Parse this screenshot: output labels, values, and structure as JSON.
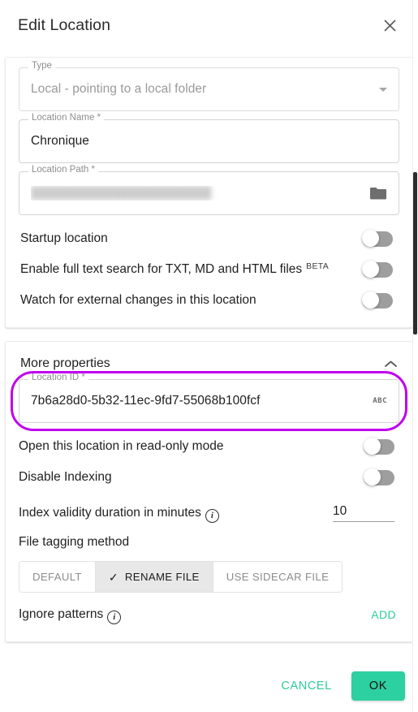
{
  "dialog": {
    "title": "Edit Location",
    "close_icon": "close-icon"
  },
  "fields": {
    "type": {
      "legend": "Type",
      "value": "Local - pointing to a local folder",
      "disabled": true,
      "adornment_icon": "chevron-down-icon"
    },
    "location_name": {
      "legend": "Location Name *",
      "value": "Chronique"
    },
    "location_path": {
      "legend": "Location Path *",
      "value": "██████████████████████",
      "redacted": true,
      "adornment_icon": "folder-icon"
    },
    "location_id": {
      "legend": "Location ID *",
      "value": "7b6a28d0-5b32-11ec-9fd7-55068b100fcf",
      "adornment_icon": "abc-icon",
      "adornment_label": "ABC",
      "highlighted": true
    }
  },
  "toggles": [
    {
      "label": "Startup location",
      "state": "off"
    },
    {
      "label": "Enable full text search for TXT, MD and HTML files",
      "badge": "BETA",
      "state": "off"
    },
    {
      "label": "Watch for external changes in this location",
      "state": "off"
    }
  ],
  "more_properties": {
    "title": "More properties",
    "expanded": true,
    "chevron_icon": "chevron-up-icon",
    "toggles": [
      {
        "label": "Open this location in read-only mode",
        "state": "off"
      },
      {
        "label": "Disable Indexing",
        "state": "off"
      }
    ],
    "index_validity": {
      "label": "Index validity duration in minutes",
      "info_icon": "info-icon",
      "value": "10"
    },
    "file_tagging": {
      "label": "File tagging method",
      "options": [
        {
          "label": "DEFAULT",
          "selected": false
        },
        {
          "label": "RENAME FILE",
          "selected": true,
          "check_icon": "check-icon"
        },
        {
          "label": "USE SIDECAR FILE",
          "selected": false
        }
      ]
    },
    "ignore_patterns": {
      "label": "Ignore patterns",
      "info_icon": "info-icon",
      "add_label": "ADD"
    }
  },
  "footer": {
    "cancel_label": "CANCEL",
    "ok_label": "OK"
  },
  "colors": {
    "accent_green": "#2ecc9b",
    "primary_button": "#2dd0a0",
    "highlight_ring": "#c000f0",
    "toggle_off_track": "#9e9e9e"
  }
}
